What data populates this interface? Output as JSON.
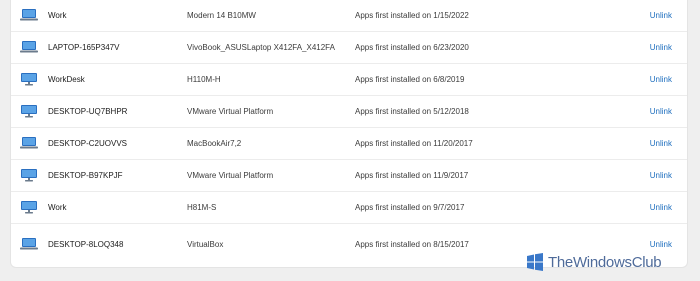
{
  "devices": [
    {
      "name": "Work",
      "model": "Modern 14 B10MW",
      "apps_text": "Apps first installed on 1/15/2022",
      "action": "Unlink"
    },
    {
      "name": "LAPTOP-165P347V",
      "model": "VivoBook_ASUSLaptop X412FA_X412FA",
      "apps_text": "Apps first installed on 6/23/2020",
      "action": "Unlink"
    },
    {
      "name": "WorkDesk",
      "model": "H110M-H",
      "apps_text": "Apps first installed on 6/8/2019",
      "action": "Unlink"
    },
    {
      "name": "DESKTOP-UQ7BHPR",
      "model": "VMware Virtual Platform",
      "apps_text": "Apps first installed on 5/12/2018",
      "action": "Unlink"
    },
    {
      "name": "DESKTOP-C2UOVVS",
      "model": "MacBookAir7,2",
      "apps_text": "Apps first installed on 11/20/2017",
      "action": "Unlink"
    },
    {
      "name": "DESKTOP-B97KPJF",
      "model": "VMware Virtual Platform",
      "apps_text": "Apps first installed on 11/9/2017",
      "action": "Unlink"
    },
    {
      "name": "Work",
      "model": "H81M-S",
      "apps_text": "Apps first installed on 9/7/2017",
      "action": "Unlink"
    },
    {
      "name": "DESKTOP-8LOQ348",
      "model": "VirtualBox",
      "apps_text": "Apps first installed on 8/15/2017",
      "action": "Unlink"
    }
  ],
  "watermark": {
    "text": "TheWindowsClub"
  },
  "colors": {
    "link": "#1f6fbf",
    "icon": "#2a6fc0"
  }
}
